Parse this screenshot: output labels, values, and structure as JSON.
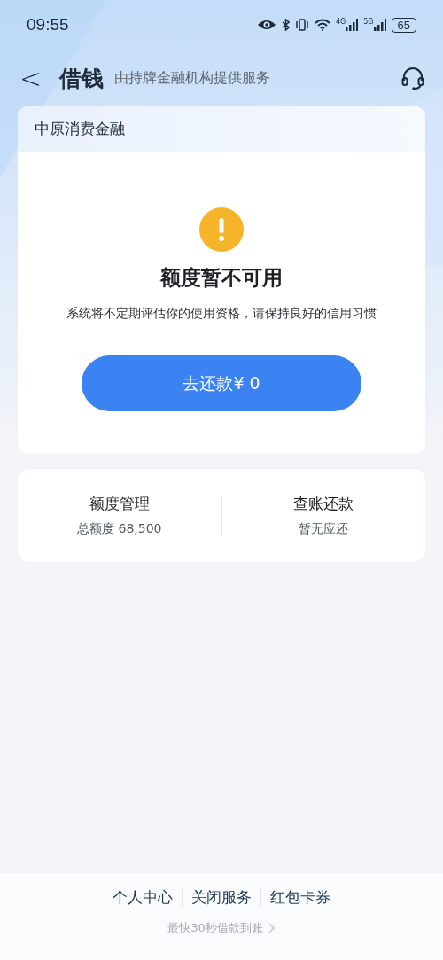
{
  "status_bar": {
    "time": "09:55",
    "network_labels": [
      "4G",
      "5G"
    ],
    "battery": "65"
  },
  "header": {
    "back": "<",
    "title": "借钱",
    "subtitle": "由持牌金融机构提供服务"
  },
  "loan_card": {
    "lender": "中原消费金融",
    "status_title": "额度暂不可用",
    "status_message": "系统将不定期评估你的使用资格，请保持良好的信用习惯",
    "button": "去还款¥ 0"
  },
  "summary": [
    {
      "title": "额度管理",
      "detail": "总额度 68,500"
    },
    {
      "title": "查账还款",
      "detail": "暂无应还"
    }
  ],
  "footer": {
    "links": [
      "个人中心",
      "关闭服务",
      "红包卡券"
    ],
    "tagline": "最快30秒借款到账"
  }
}
